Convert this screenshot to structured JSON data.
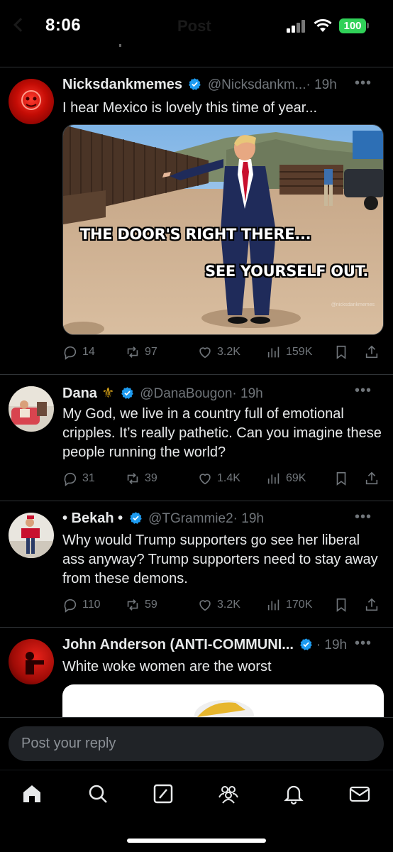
{
  "status_bar": {
    "time": "8:06",
    "faded_title": "Post",
    "battery": "100"
  },
  "posts": [
    {
      "display_name": "Nicksdankmemes",
      "handle": "@Nicksdankm...",
      "time": "· 19h",
      "text": "I hear Mexico is lovely this time of year...",
      "media": {
        "line1": "THE DOOR'S RIGHT THERE...",
        "line2": "SEE YOURSELF OUT.",
        "watermark": "@nicksdankmemes"
      },
      "replies": "14",
      "reposts": "97",
      "likes": "3.2K",
      "views": "159K"
    },
    {
      "display_name": "Dana",
      "name_emoji": "⚜",
      "handle": "@DanaBougon",
      "time": "· 19h",
      "text": "My God, we live in a country full of emotional cripples.  It’s really pathetic.  Can you imagine these people running the world?",
      "replies": "31",
      "reposts": "39",
      "likes": "1.4K",
      "views": "69K"
    },
    {
      "display_name": "• Bekah •",
      "handle": "@TGrammie2",
      "time": "· 19h",
      "text": "Why would Trump supporters go see her liberal ass anyway? Trump supporters need to stay away from these demons.",
      "replies": "110",
      "reposts": "59",
      "likes": "3.2K",
      "views": "170K"
    },
    {
      "display_name": "John Anderson (ANTI-COMMUNI...",
      "handle": "",
      "time": "· 19h",
      "text": "White woke women are the worst"
    }
  ],
  "reply_bar": {
    "placeholder": "Post your reply"
  },
  "tabs": [
    "home-icon",
    "search-icon",
    "grok-icon",
    "communities-icon",
    "notifications-icon",
    "messages-icon"
  ],
  "colors": {
    "verified": "#1d9bf0",
    "muted": "#71767b",
    "battery": "#30d158"
  }
}
